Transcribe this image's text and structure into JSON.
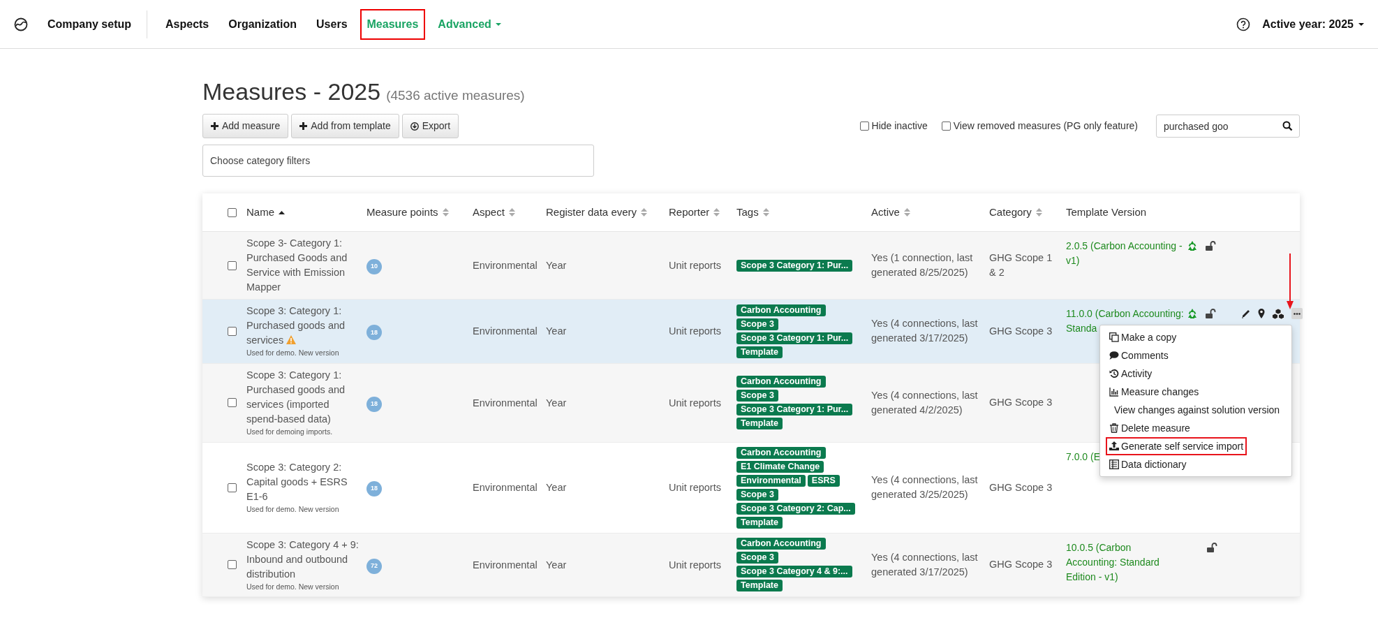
{
  "nav": {
    "brand": "Company setup",
    "items": [
      {
        "label": "Aspects",
        "selected": false,
        "highlighted": false,
        "kind": "link"
      },
      {
        "label": "Organization",
        "selected": false,
        "highlighted": false,
        "kind": "link"
      },
      {
        "label": "Users",
        "selected": false,
        "highlighted": false,
        "kind": "link"
      },
      {
        "label": "Measures",
        "selected": true,
        "highlighted": true,
        "kind": "link"
      },
      {
        "label": "Advanced",
        "selected": true,
        "highlighted": false,
        "kind": "dropdown"
      }
    ],
    "year": "Active year: 2025"
  },
  "title": "Measures - 2025",
  "subtitle": "(4536 active measures)",
  "buttons": [
    {
      "label": "Add measure",
      "kind": "plus"
    },
    {
      "label": "Add from template",
      "kind": "plus"
    },
    {
      "label": "Export",
      "kind": "download"
    }
  ],
  "options": [
    {
      "label": "Hide inactive",
      "checked": false
    },
    {
      "label": "View removed measures (PG only feature)",
      "checked": false
    }
  ],
  "search": {
    "value": "purchased goo"
  },
  "filter": {
    "placeholder": "Choose category filters"
  },
  "table": {
    "select_all": {
      "checked": false
    },
    "columns": [
      {
        "label": "Name",
        "kind": "sorted"
      },
      {
        "label": "Measure points",
        "kind": "sortable"
      },
      {
        "label": "Aspect",
        "kind": "sortable"
      },
      {
        "label": "Register data every",
        "kind": "sortable"
      },
      {
        "label": "Reporter",
        "kind": "sortable"
      },
      {
        "label": "Tags",
        "kind": "sortable"
      },
      {
        "label": "Active",
        "kind": "sortable"
      },
      {
        "label": "Category",
        "kind": "sortable"
      },
      {
        "label": "Template Version",
        "kind": "plain"
      }
    ],
    "rows": [
      {
        "checked": false,
        "selected": false,
        "name": "Scope 3- Category 1: Purchased Goods and Service with Emission Mapper",
        "warning": false,
        "points": "10",
        "aspect": "Environmental",
        "frequency": "Year",
        "reporter": "Unit reports",
        "tags": [
          "Scope 3 Category 1: Pur..."
        ],
        "active": "Yes (1 connection, last generated 8/25/2025)",
        "category": "GHG Scope 1 & 2",
        "template": "2.0.5 (Carbon Accounting - v1)",
        "icons": [
          {
            "kind": "recycle"
          },
          {
            "kind": "unlock"
          }
        ]
      },
      {
        "checked": false,
        "selected": true,
        "name": "Scope 3: Category 1: Purchased goods and services",
        "warning": true,
        "note": "Used for demo. New version",
        "points": "18",
        "aspect": "Environmental",
        "frequency": "Year",
        "reporter": "Unit reports",
        "tags": [
          "Carbon Accounting",
          "Scope 3",
          "Scope 3 Category 1: Pur...",
          "Template"
        ],
        "active": "Yes (4 connections, last generated 3/17/2025)",
        "category": "GHG Scope 3",
        "template": "11.0.0 (Carbon Accounting: Standa",
        "icons": [
          {
            "kind": "recycle"
          },
          {
            "kind": "unlock"
          },
          {
            "kind": "edit"
          },
          {
            "kind": "pin"
          },
          {
            "kind": "cubes"
          },
          {
            "kind": "more"
          }
        ]
      },
      {
        "checked": false,
        "selected": false,
        "name": "Scope 3: Category 1: Purchased goods and services (imported spend-based data)",
        "warning": false,
        "note": "Used for demoing imports.",
        "points": "18",
        "aspect": "Environmental",
        "frequency": "Year",
        "reporter": "Unit reports",
        "tags": [
          "Carbon Accounting",
          "Scope 3",
          "Scope 3 Category 1: Pur...",
          "Template"
        ],
        "active": "Yes (4 connections, last generated 4/2/2025)",
        "category": "GHG Scope 3",
        "icons": []
      },
      {
        "checked": false,
        "selected": false,
        "name": "Scope 3: Category 2: Capital goods + ESRS E1-6",
        "warning": false,
        "note": "Used for demo. New version",
        "points": "18",
        "aspect": "Environmental",
        "frequency": "Year",
        "reporter": "Unit reports",
        "tags": [
          "Carbon Accounting",
          "E1 Climate Change",
          "Environmental",
          "ESRS",
          "Scope 3",
          "Scope 3 Category 2: Cap...",
          "Template"
        ],
        "active": "Yes (4 connections, last generated 3/25/2025)",
        "category": "GHG Scope 3",
        "template": "7.0.0 (E",
        "icons": []
      },
      {
        "checked": false,
        "selected": false,
        "name": "Scope 3: Category 4 + 9: Inbound and outbound distribution",
        "warning": false,
        "note": "Used for demo. New version",
        "points": "72",
        "aspect": "Environmental",
        "frequency": "Year",
        "reporter": "Unit reports",
        "tags": [
          "Carbon Accounting",
          "Scope 3",
          "Scope 3 Category 4 & 9:...",
          "Template"
        ],
        "active": "Yes (4 connections, last generated 3/17/2025)",
        "category": "GHG Scope 3",
        "template": "10.0.5 (Carbon Accounting: Standard Edition - v1)",
        "icons": [
          {
            "kind": "unlock"
          }
        ]
      }
    ]
  },
  "menu": {
    "items": [
      {
        "label": "Make a copy",
        "kind": "copy",
        "highlighted": false
      },
      {
        "label": "Comments",
        "kind": "comment",
        "highlighted": false
      },
      {
        "label": "Activity",
        "kind": "history",
        "highlighted": false
      },
      {
        "label": "Measure changes",
        "kind": "chart",
        "highlighted": false
      },
      {
        "label": "View changes against solution version",
        "kind": "plain",
        "highlighted": false
      },
      {
        "label": "Delete measure",
        "kind": "trash",
        "highlighted": false
      },
      {
        "label": "Generate self service import",
        "kind": "upload",
        "highlighted": true
      },
      {
        "label": "Data dictionary",
        "kind": "book",
        "highlighted": false
      }
    ]
  }
}
